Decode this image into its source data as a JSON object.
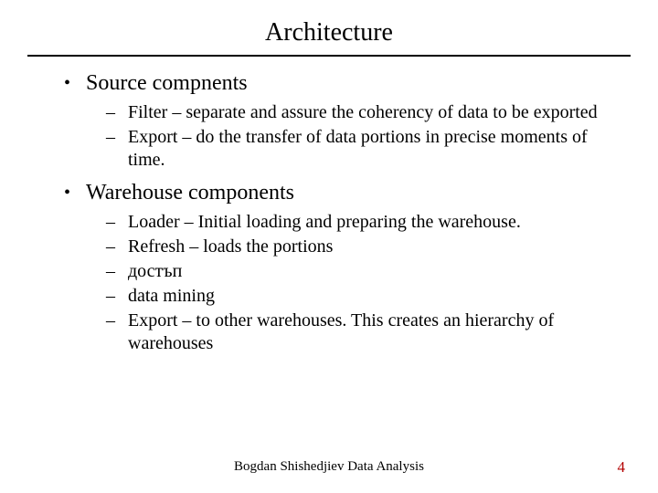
{
  "title": "Architecture",
  "bullets": {
    "item0": {
      "label": "Source compnents",
      "sub0": "Filter – separate and assure the coherency of data to be exported",
      "sub1": "Export – do the transfer of data portions in precise moments of time."
    },
    "item1": {
      "label": "Warehouse components",
      "sub0": "Loader – Initial loading and preparing the warehouse.",
      "sub1": "Refresh – loads the portions",
      "sub2": "достъп",
      "sub3": "data mining",
      "sub4": "Export – to other warehouses. This creates an hierarchy of warehouses"
    }
  },
  "footer": "Bogdan Shishedjiev Data Analysis",
  "page_number": "4"
}
